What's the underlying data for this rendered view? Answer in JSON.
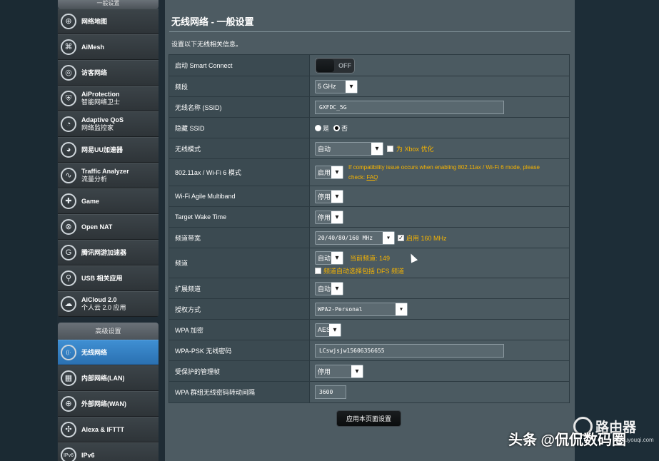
{
  "sidebar": {
    "general_header": "一般设置",
    "general_items": [
      {
        "icon": "globe-map-icon",
        "glyph": "⊕",
        "label": "网络地图",
        "sub": ""
      },
      {
        "icon": "mesh-icon",
        "glyph": "⌘",
        "label": "AiMesh",
        "sub": ""
      },
      {
        "icon": "guest-network-icon",
        "glyph": "◎",
        "label": "访客网络",
        "sub": ""
      },
      {
        "icon": "shield-icon",
        "glyph": "⛨",
        "label": "AiProtection",
        "sub": "智能网络卫士"
      },
      {
        "icon": "speedometer-icon",
        "glyph": "◔",
        "label": "Adaptive QoS",
        "sub": "网络监控家"
      },
      {
        "icon": "accelerator-icon",
        "glyph": "◕",
        "label": "网易UU加速器",
        "sub": ""
      },
      {
        "icon": "traffic-analyzer-icon",
        "glyph": "∿",
        "label": "Traffic Analyzer",
        "sub": "流量分析"
      },
      {
        "icon": "gamepad-icon",
        "glyph": "✚",
        "label": "Game",
        "sub": ""
      },
      {
        "icon": "open-nat-icon",
        "glyph": "⊗",
        "label": "Open NAT",
        "sub": ""
      },
      {
        "icon": "game-booster-icon",
        "glyph": "G",
        "label": "腾讯网游加速器",
        "sub": ""
      },
      {
        "icon": "usb-icon",
        "glyph": "⚲",
        "label": "USB 相关应用",
        "sub": ""
      },
      {
        "icon": "cloud-icon",
        "glyph": "☁",
        "label": "AiCloud 2.0",
        "sub": "个人云 2.0 应用"
      }
    ],
    "advanced_header": "高级设置",
    "advanced_items": [
      {
        "icon": "wireless-icon",
        "glyph": "((·",
        "label": "无线网络",
        "sub": "",
        "active": true
      },
      {
        "icon": "lan-icon",
        "glyph": "▦",
        "label": "内部网络(LAN)",
        "sub": "",
        "active": false
      },
      {
        "icon": "wan-icon",
        "glyph": "⊕",
        "label": "外部网络(WAN)",
        "sub": "",
        "active": false
      },
      {
        "icon": "alexa-icon",
        "glyph": "✣",
        "label": "Alexa & IFTTT",
        "sub": "",
        "active": false
      },
      {
        "icon": "ipv6-icon",
        "glyph": "IPv6",
        "label": "IPv6",
        "sub": "",
        "active": false
      }
    ]
  },
  "page": {
    "title": "无线网络 - 一般设置",
    "description": "设置以下无线相关信息。",
    "apply_button": "应用本页面设置"
  },
  "form": {
    "smart_connect": {
      "label": "启动 Smart Connect",
      "state": "OFF"
    },
    "band": {
      "label": "频段",
      "value": "5 GHz"
    },
    "ssid": {
      "label": "无线名称 (SSID)",
      "value": "GXFDC_5G"
    },
    "hide_ssid": {
      "label": "隐藏 SSID",
      "opt_yes": "是",
      "opt_no": "否",
      "selected": "否"
    },
    "wireless_mode": {
      "label": "无线模式",
      "value": "自动",
      "xbox_label": "为 Xbox 优化"
    },
    "ax_mode": {
      "label": "802.11ax / Wi-Fi 6 模式",
      "value": "启用",
      "note": "If compatibility issue occurs when enabling 802.11ax / Wi-Fi 6 mode, please check:",
      "faq": "FAQ"
    },
    "agile_multiband": {
      "label": "Wi-Fi Agile Multiband",
      "value": "停用"
    },
    "target_wake_time": {
      "label": "Target Wake Time",
      "value": "停用"
    },
    "bandwidth": {
      "label": "频道带宽",
      "value": "20/40/80/160 MHz",
      "check_label": "启用 160 MHz"
    },
    "channel": {
      "label": "频道",
      "value": "自动",
      "current": "当前频道: 149",
      "dfs_label": "频道自动选择包括 DFS 频道"
    },
    "ext_channel": {
      "label": "扩展频道",
      "value": "自动"
    },
    "auth": {
      "label": "授权方式",
      "value": "WPA2-Personal"
    },
    "wpa_enc": {
      "label": "WPA 加密",
      "value": "AES"
    },
    "wpa_psk": {
      "label": "WPA-PSK 无线密码",
      "value": "LCswjsjw15606356655"
    },
    "pmf": {
      "label": "受保护的管理帧",
      "value": "停用"
    },
    "group_key": {
      "label": "WPA 群组无线密码转动间隔",
      "value": "3600"
    }
  },
  "overlay": {
    "watermark": "头条 @侃侃数码圈",
    "logo_text": "路由器",
    "logo_sub": "luyouqi.com"
  }
}
